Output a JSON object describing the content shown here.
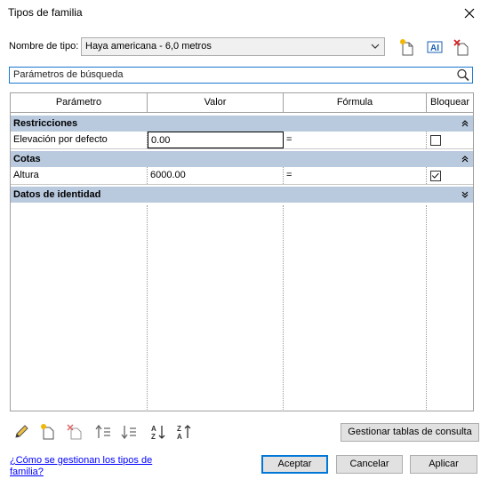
{
  "window": {
    "title": "Tipos de familia"
  },
  "type_selector": {
    "label": "Nombre de tipo:",
    "value": "Haya americana - 6,0 metros"
  },
  "search": {
    "placeholder": "Parámetros de búsqueda"
  },
  "grid": {
    "columns": [
      "Parámetro",
      "Valor",
      "Fórmula",
      "Bloquear"
    ],
    "groups": [
      {
        "name": "Restricciones",
        "state": "expanded",
        "rows": [
          {
            "parameter": "Elevación por defecto",
            "value": "0.00",
            "formula": "=",
            "locked": false
          }
        ]
      },
      {
        "name": "Cotas",
        "state": "expanded",
        "rows": [
          {
            "parameter": "Altura",
            "value": "6000.00",
            "formula": "=",
            "locked": true
          }
        ]
      },
      {
        "name": "Datos de identidad",
        "state": "collapsed",
        "rows": []
      }
    ]
  },
  "toolbar_icons": [
    "edit-pencil-icon",
    "new-parameter-icon",
    "delete-parameter-icon",
    "move-up-icon",
    "move-down-icon",
    "sort-ascending-icon",
    "sort-descending-icon"
  ],
  "buttons": {
    "manage_lookup": "Gestionar tablas de consulta",
    "ok": "Aceptar",
    "cancel": "Cancelar",
    "apply": "Aplicar"
  },
  "help_link": "¿Cómo se gestionan los tipos de familia?",
  "colors": {
    "group_header": "#b9c9de",
    "accent": "#0078d7",
    "link": "#0000ff"
  }
}
